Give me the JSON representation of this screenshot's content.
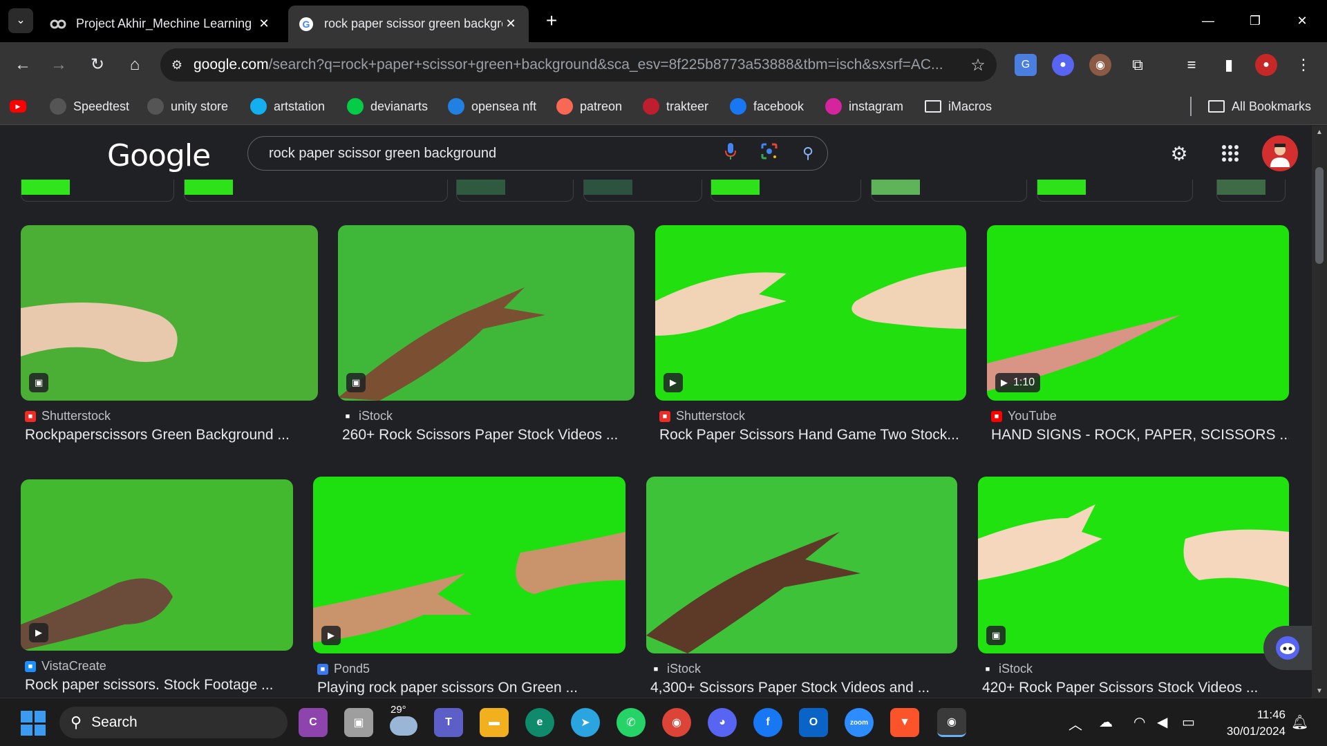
{
  "browser": {
    "tabs": [
      {
        "title": "Project Akhir_Mechine Learning",
        "favicon": "colab-icon",
        "active": false
      },
      {
        "title": "rock paper scissor green background",
        "favicon": "google-icon",
        "active": true
      }
    ],
    "url_host": "google.com",
    "url_rest": "/search?q=rock+paper+scissor+green+background&sca_esv=8f225b8773a53888&tbm=isch&sxsrf=AC...",
    "bookmarks": [
      {
        "label": "",
        "icon": "youtube-icon",
        "color": "#ff0000"
      },
      {
        "label": "Speedtest",
        "icon": "speedtest-icon",
        "color": "#555"
      },
      {
        "label": "unity store",
        "icon": "unity-icon",
        "color": "#555"
      },
      {
        "label": "artstation",
        "icon": "artstation-icon",
        "color": "#13aff0"
      },
      {
        "label": "devianarts",
        "icon": "deviantart-icon",
        "color": "#05cc47"
      },
      {
        "label": "opensea nft",
        "icon": "opensea-icon",
        "color": "#2081e2"
      },
      {
        "label": "patreon",
        "icon": "patreon-icon",
        "color": "#f96854"
      },
      {
        "label": "trakteer",
        "icon": "trakteer-icon",
        "color": "#be1e2d"
      },
      {
        "label": "facebook",
        "icon": "facebook-icon",
        "color": "#1877f2"
      },
      {
        "label": "instagram",
        "icon": "instagram-icon",
        "color": "#d6249f"
      },
      {
        "label": "iMacros",
        "icon": "folder-icon",
        "color": "transparent"
      }
    ],
    "all_bookmarks": "All Bookmarks"
  },
  "google": {
    "logo": "Google",
    "query": "rock paper scissor green background"
  },
  "results": [
    {
      "source": "Shutterstock",
      "source_icon": "shutterstock-icon",
      "source_color": "#ee2b24",
      "title": "Rockpaperscissors Green Background ...",
      "badge": "",
      "badge_type": "image",
      "bg": "#4caf35"
    },
    {
      "source": "iStock",
      "source_icon": "istock-icon",
      "source_color": "#202124",
      "title": "260+ Rock Scissors Paper Stock Videos ...",
      "badge": "",
      "badge_type": "image",
      "bg": "#3fb83a"
    },
    {
      "source": "Shutterstock",
      "source_icon": "shutterstock-icon",
      "source_color": "#ee2b24",
      "title": "Rock Paper Scissors Hand Game Two Stock...",
      "badge": "",
      "badge_type": "video",
      "bg": "#22e010"
    },
    {
      "source": "YouTube",
      "source_icon": "youtube-icon",
      "source_color": "#ff0000",
      "title": "HAND SIGNS - ROCK, PAPER, SCISSORS ...",
      "badge": "1:10",
      "badge_type": "video",
      "bg": "#1fe20c"
    },
    {
      "source": "VistaCreate",
      "source_icon": "vistacreate-icon",
      "source_color": "#1c8fff",
      "title": "Rock paper scissors. Stock Footage ...",
      "badge": "",
      "badge_type": "video",
      "bg": "#43b92f"
    },
    {
      "source": "Pond5",
      "source_icon": "pond5-icon",
      "source_color": "#3a78f2",
      "title": "Playing rock paper scissors On Green ...",
      "badge": "",
      "badge_type": "video",
      "bg": "#1ee010"
    },
    {
      "source": "iStock",
      "source_icon": "istock-icon",
      "source_color": "#202124",
      "title": "4,300+ Scissors Paper Stock Videos and ...",
      "badge": "",
      "badge_type": "none",
      "bg": "#3ec23a"
    },
    {
      "source": "iStock",
      "source_icon": "istock-icon",
      "source_color": "#202124",
      "title": "420+ Rock Paper Scissors Stock Videos ...",
      "badge": "",
      "badge_type": "image",
      "bg": "#1fe20e"
    }
  ],
  "taskbar": {
    "search_label": "Search",
    "weather_temp": "29°",
    "time": "11:46",
    "date": "30/01/2024"
  }
}
